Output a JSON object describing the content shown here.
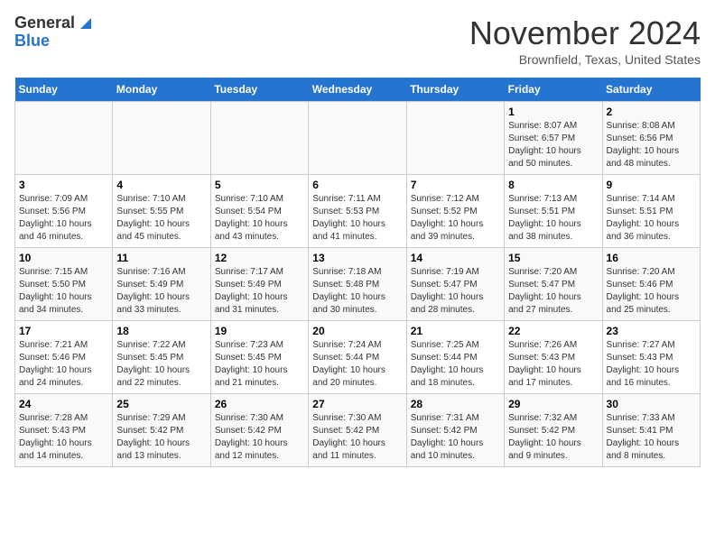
{
  "logo": {
    "line1": "General",
    "line2": "Blue"
  },
  "title": "November 2024",
  "subtitle": "Brownfield, Texas, United States",
  "days_of_week": [
    "Sunday",
    "Monday",
    "Tuesday",
    "Wednesday",
    "Thursday",
    "Friday",
    "Saturday"
  ],
  "weeks": [
    [
      {
        "day": "",
        "info": ""
      },
      {
        "day": "",
        "info": ""
      },
      {
        "day": "",
        "info": ""
      },
      {
        "day": "",
        "info": ""
      },
      {
        "day": "",
        "info": ""
      },
      {
        "day": "1",
        "info": "Sunrise: 8:07 AM\nSunset: 6:57 PM\nDaylight: 10 hours\nand 50 minutes."
      },
      {
        "day": "2",
        "info": "Sunrise: 8:08 AM\nSunset: 6:56 PM\nDaylight: 10 hours\nand 48 minutes."
      }
    ],
    [
      {
        "day": "3",
        "info": "Sunrise: 7:09 AM\nSunset: 5:56 PM\nDaylight: 10 hours\nand 46 minutes."
      },
      {
        "day": "4",
        "info": "Sunrise: 7:10 AM\nSunset: 5:55 PM\nDaylight: 10 hours\nand 45 minutes."
      },
      {
        "day": "5",
        "info": "Sunrise: 7:10 AM\nSunset: 5:54 PM\nDaylight: 10 hours\nand 43 minutes."
      },
      {
        "day": "6",
        "info": "Sunrise: 7:11 AM\nSunset: 5:53 PM\nDaylight: 10 hours\nand 41 minutes."
      },
      {
        "day": "7",
        "info": "Sunrise: 7:12 AM\nSunset: 5:52 PM\nDaylight: 10 hours\nand 39 minutes."
      },
      {
        "day": "8",
        "info": "Sunrise: 7:13 AM\nSunset: 5:51 PM\nDaylight: 10 hours\nand 38 minutes."
      },
      {
        "day": "9",
        "info": "Sunrise: 7:14 AM\nSunset: 5:51 PM\nDaylight: 10 hours\nand 36 minutes."
      }
    ],
    [
      {
        "day": "10",
        "info": "Sunrise: 7:15 AM\nSunset: 5:50 PM\nDaylight: 10 hours\nand 34 minutes."
      },
      {
        "day": "11",
        "info": "Sunrise: 7:16 AM\nSunset: 5:49 PM\nDaylight: 10 hours\nand 33 minutes."
      },
      {
        "day": "12",
        "info": "Sunrise: 7:17 AM\nSunset: 5:49 PM\nDaylight: 10 hours\nand 31 minutes."
      },
      {
        "day": "13",
        "info": "Sunrise: 7:18 AM\nSunset: 5:48 PM\nDaylight: 10 hours\nand 30 minutes."
      },
      {
        "day": "14",
        "info": "Sunrise: 7:19 AM\nSunset: 5:47 PM\nDaylight: 10 hours\nand 28 minutes."
      },
      {
        "day": "15",
        "info": "Sunrise: 7:20 AM\nSunset: 5:47 PM\nDaylight: 10 hours\nand 27 minutes."
      },
      {
        "day": "16",
        "info": "Sunrise: 7:20 AM\nSunset: 5:46 PM\nDaylight: 10 hours\nand 25 minutes."
      }
    ],
    [
      {
        "day": "17",
        "info": "Sunrise: 7:21 AM\nSunset: 5:46 PM\nDaylight: 10 hours\nand 24 minutes."
      },
      {
        "day": "18",
        "info": "Sunrise: 7:22 AM\nSunset: 5:45 PM\nDaylight: 10 hours\nand 22 minutes."
      },
      {
        "day": "19",
        "info": "Sunrise: 7:23 AM\nSunset: 5:45 PM\nDaylight: 10 hours\nand 21 minutes."
      },
      {
        "day": "20",
        "info": "Sunrise: 7:24 AM\nSunset: 5:44 PM\nDaylight: 10 hours\nand 20 minutes."
      },
      {
        "day": "21",
        "info": "Sunrise: 7:25 AM\nSunset: 5:44 PM\nDaylight: 10 hours\nand 18 minutes."
      },
      {
        "day": "22",
        "info": "Sunrise: 7:26 AM\nSunset: 5:43 PM\nDaylight: 10 hours\nand 17 minutes."
      },
      {
        "day": "23",
        "info": "Sunrise: 7:27 AM\nSunset: 5:43 PM\nDaylight: 10 hours\nand 16 minutes."
      }
    ],
    [
      {
        "day": "24",
        "info": "Sunrise: 7:28 AM\nSunset: 5:43 PM\nDaylight: 10 hours\nand 14 minutes."
      },
      {
        "day": "25",
        "info": "Sunrise: 7:29 AM\nSunset: 5:42 PM\nDaylight: 10 hours\nand 13 minutes."
      },
      {
        "day": "26",
        "info": "Sunrise: 7:30 AM\nSunset: 5:42 PM\nDaylight: 10 hours\nand 12 minutes."
      },
      {
        "day": "27",
        "info": "Sunrise: 7:30 AM\nSunset: 5:42 PM\nDaylight: 10 hours\nand 11 minutes."
      },
      {
        "day": "28",
        "info": "Sunrise: 7:31 AM\nSunset: 5:42 PM\nDaylight: 10 hours\nand 10 minutes."
      },
      {
        "day": "29",
        "info": "Sunrise: 7:32 AM\nSunset: 5:42 PM\nDaylight: 10 hours\nand 9 minutes."
      },
      {
        "day": "30",
        "info": "Sunrise: 7:33 AM\nSunset: 5:41 PM\nDaylight: 10 hours\nand 8 minutes."
      }
    ]
  ]
}
